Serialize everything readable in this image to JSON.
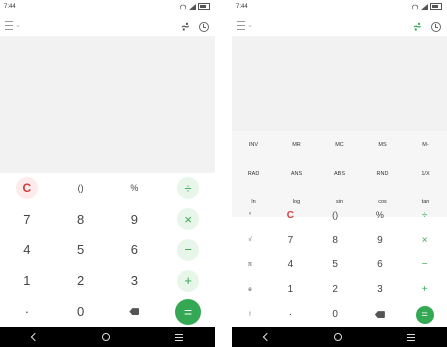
{
  "status": {
    "time": "7:44"
  },
  "left": {
    "keys": [
      [
        "C",
        "()",
        "%",
        "÷"
      ],
      [
        "7",
        "8",
        "9",
        "×"
      ],
      [
        "4",
        "5",
        "6",
        "−"
      ],
      [
        "1",
        "2",
        "3",
        "+"
      ],
      [
        "·",
        "0",
        "",
        "="
      ]
    ]
  },
  "right": {
    "sci": [
      [
        "INV",
        "MR",
        "MC",
        "MS",
        "M-"
      ],
      [
        "RAD",
        "ANS",
        "ABS",
        "RND",
        "1/X"
      ],
      [
        "ln",
        "log",
        "sin",
        "cos",
        "tan"
      ]
    ],
    "func_col": [
      "ˣ",
      "√",
      "π",
      "e",
      "!"
    ],
    "keys": [
      [
        "C",
        "()",
        "%",
        "÷"
      ],
      [
        "7",
        "8",
        "9",
        "×"
      ],
      [
        "4",
        "5",
        "6",
        "−"
      ],
      [
        "1",
        "2",
        "3",
        "+"
      ],
      [
        "·",
        "0",
        "",
        "="
      ]
    ]
  },
  "icons": {
    "format": "format-icon",
    "dropdown": "chevron-down-icon",
    "converter": "converter-icon",
    "history": "history-icon",
    "backspace": "backspace-icon",
    "nav_back": "back-icon",
    "nav_home": "home-icon",
    "nav_menu": "menu-icon"
  },
  "colors": {
    "accent": "#34a853",
    "clear": "#d33c3c",
    "display_bg": "#f2f2f2"
  }
}
